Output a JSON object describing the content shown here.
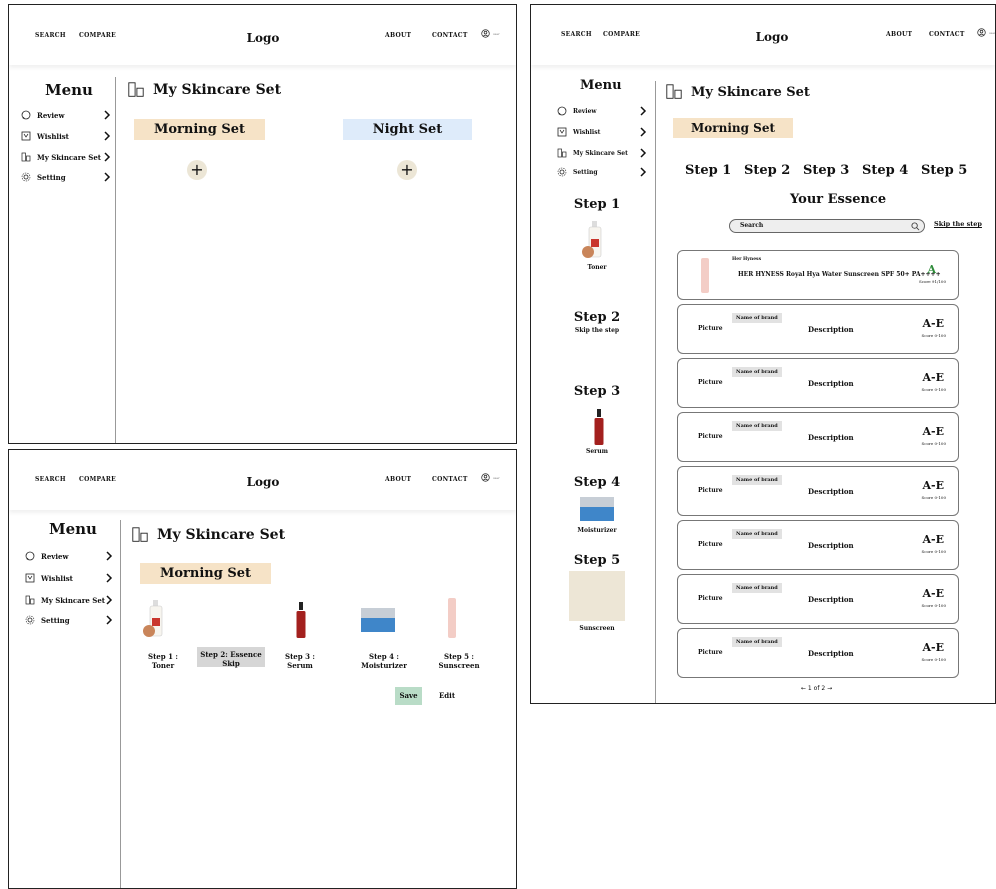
{
  "header": {
    "search": "SEARCH",
    "compare": "COMPARE",
    "logo": "Logo",
    "about": "ABOUT",
    "contact": "CONTACT",
    "user_label": "user"
  },
  "menu": {
    "title": "Menu",
    "items": [
      {
        "label": "Review",
        "icon": "chat-bubble-icon"
      },
      {
        "label": "Wishlist",
        "icon": "bookmark-icon"
      },
      {
        "label": "My Skincare Set",
        "icon": "skincare-set-icon"
      },
      {
        "label": "Setting",
        "icon": "gear-icon"
      }
    ]
  },
  "page_title": "My Skincare Set",
  "panel1": {
    "morning": "Morning Set",
    "night": "Night Set",
    "add": "+"
  },
  "panel2": {
    "morning": "Morning Set",
    "steps": [
      "Step 1 : Toner",
      "Step 2: Essence Skip",
      "Step 3 : Serum",
      "Step 4 : Moisturizer",
      "Step 5 : Sunscreen"
    ],
    "save": "Save",
    "edit": "Edit"
  },
  "panel3": {
    "morning": "Morning Set",
    "tabs": [
      "Step 1",
      "Step 2",
      "Step 3",
      "Step 4",
      "Step 5"
    ],
    "section_title": "Your Essence",
    "search_placeholder": "Search",
    "skip": "Skip the step",
    "sidebar_steps": [
      {
        "title": "Step 1",
        "caption": "Toner"
      },
      {
        "title": "Step 2",
        "caption": "Skip the step"
      },
      {
        "title": "Step 3",
        "caption": "Serum"
      },
      {
        "title": "Step 4",
        "caption": "Moisturizer"
      },
      {
        "title": "Step 5",
        "caption": "Sunscreen"
      }
    ],
    "featured": {
      "brand": "Her Hyness",
      "name": "HER HYNESS Royal Hya Water Sunscreen SPF 50+ PA++++",
      "grade": "A",
      "score": "Score 91/100",
      "grade_color": "#2e8b3a"
    },
    "placeholder_card": {
      "picture": "Picture",
      "brand": "Name of brand",
      "description": "Description",
      "grade": "A-E",
      "score": "Score 0-100"
    },
    "pagination": "← 1 of 2 →"
  }
}
